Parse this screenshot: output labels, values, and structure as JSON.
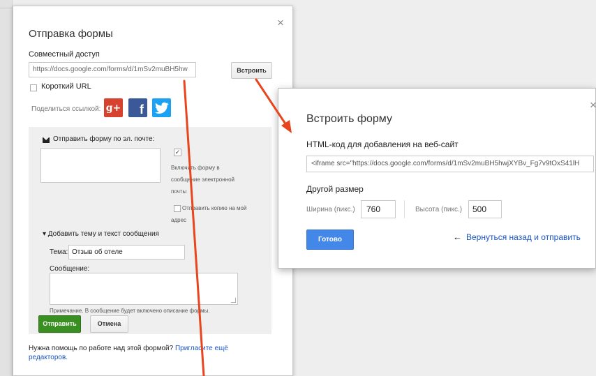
{
  "dialog1": {
    "title": "Отправка формы",
    "share_label": "Совместный доступ",
    "url_value": "https://docs.google.com/forms/d/1mSv2muBH5hw",
    "embed_button": "Встроить",
    "short_url_label": "Короткий URL",
    "share_link_label": "Поделиться ссылкой:",
    "social": {
      "gplus": "g+",
      "facebook": "f"
    },
    "close": "×",
    "email_section": {
      "title": "Отправить форму по эл. почте:",
      "include_label": "Включить форму в сообщение электронной почты",
      "include_check": "✓",
      "copy_label": "Отправить копию на мой адрес",
      "subject_toggle": "▾ Добавить тему и текст сообщения",
      "topic_label": "Тема:",
      "topic_value": "Отзыв об отеле",
      "message_label": "Сообщение:",
      "note": "Примечание. В сообщение будет включено описание формы."
    },
    "send_button": "Отправить",
    "cancel_button": "Отмена",
    "help_text": "Нужна помощь по работе над этой формой?",
    "help_link": "Пригласите ещё редакторов."
  },
  "dialog2": {
    "title": "Встроить форму",
    "html_label": "HTML-код для добавления на веб-сайт",
    "code_value": "<iframe src=\"https://docs.google.com/forms/d/1mSv2muBH5hwjXYBv_Fg7v9tOxS41lH",
    "other_size": "Другой размер",
    "width_label": "Ширина (пикс.)",
    "width_value": "760",
    "height_label": "Высота (пикс.)",
    "height_value": "500",
    "done_button": "Готово",
    "back_arrow": "←",
    "back_link": "Вернуться назад и отправить",
    "close": "×"
  },
  "colors": {
    "annotation_arrow": "#e8451e",
    "primary_blue": "#4388e8",
    "send_green": "#3a8f22",
    "link_blue": "#1a55c2"
  }
}
